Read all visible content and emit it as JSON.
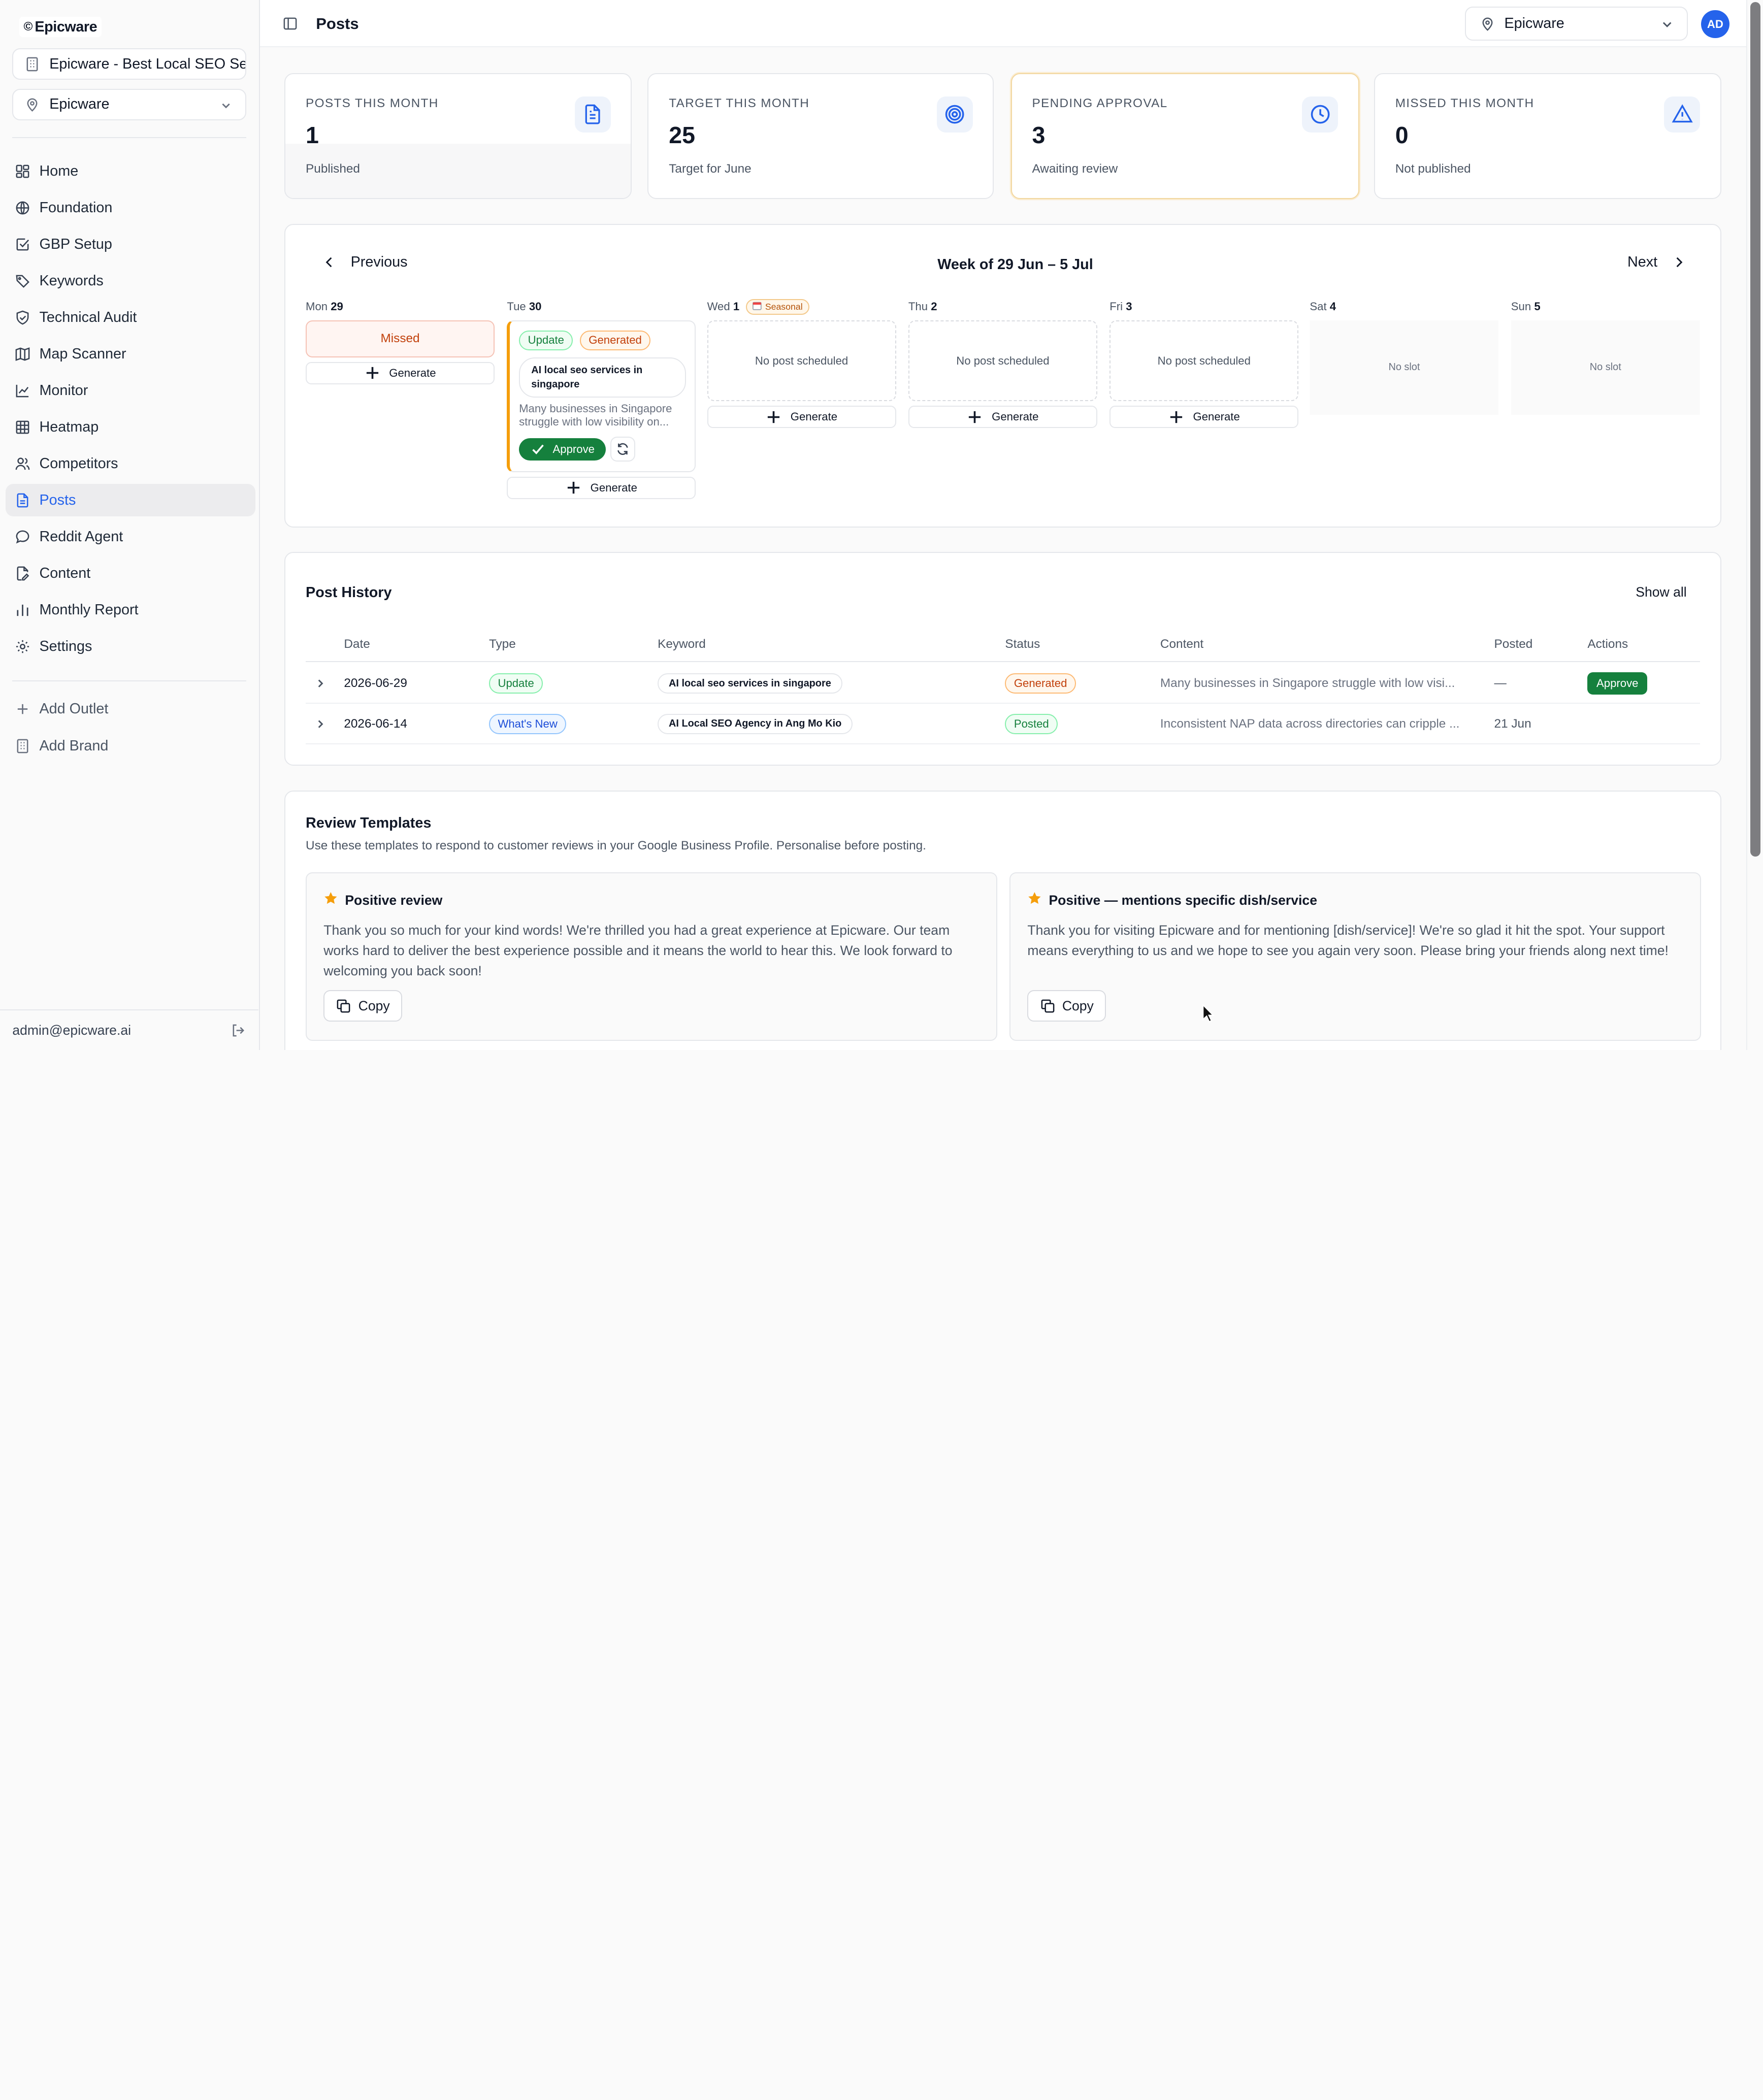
{
  "sidebar": {
    "brand": "Epicware",
    "brand_mark": "©",
    "project": "Epicware - Best Local SEO Se",
    "location": "Epicware",
    "items": [
      {
        "label": "Home",
        "icon": "dashboard-icon"
      },
      {
        "label": "Foundation",
        "icon": "globe-icon"
      },
      {
        "label": "GBP Setup",
        "icon": "checkbox-icon"
      },
      {
        "label": "Keywords",
        "icon": "tag-icon"
      },
      {
        "label": "Technical Audit",
        "icon": "shield-check-icon"
      },
      {
        "label": "Map Scanner",
        "icon": "map-icon"
      },
      {
        "label": "Monitor",
        "icon": "line-chart-icon"
      },
      {
        "label": "Heatmap",
        "icon": "grid-icon"
      },
      {
        "label": "Competitors",
        "icon": "users-icon"
      },
      {
        "label": "Posts",
        "icon": "file-icon"
      },
      {
        "label": "Reddit Agent",
        "icon": "chat-icon"
      },
      {
        "label": "Content",
        "icon": "file-edit-icon"
      },
      {
        "label": "Monthly Report",
        "icon": "bar-chart-icon"
      },
      {
        "label": "Settings",
        "icon": "gear-icon"
      }
    ],
    "active": "Posts",
    "add_outlet": "Add Outlet",
    "add_brand": "Add Brand",
    "user_email": "admin@epicware.ai"
  },
  "header": {
    "title": "Posts",
    "location": "Epicware",
    "avatar_initials": "AD"
  },
  "stats": [
    {
      "label": "POSTS THIS MONTH",
      "value": "1",
      "sub": "Published",
      "icon": "document-icon"
    },
    {
      "label": "TARGET THIS MONTH",
      "value": "25",
      "sub": "Target for June",
      "icon": "target-icon"
    },
    {
      "label": "PENDING APPROVAL",
      "value": "3",
      "sub": "Awaiting review",
      "icon": "clock-icon"
    },
    {
      "label": "MISSED THIS MONTH",
      "value": "0",
      "sub": "Not published",
      "icon": "warning-icon"
    }
  ],
  "week": {
    "prev": "Previous",
    "next": "Next",
    "title": "Week of 29 Jun – 5 Jul",
    "days": [
      {
        "name": "Mon",
        "num": "29"
      },
      {
        "name": "Tue",
        "num": "30"
      },
      {
        "name": "Wed",
        "num": "1",
        "tag": "Seasonal"
      },
      {
        "name": "Thu",
        "num": "2"
      },
      {
        "name": "Fri",
        "num": "3"
      },
      {
        "name": "Sat",
        "num": "4"
      },
      {
        "name": "Sun",
        "num": "5"
      }
    ],
    "missed": "Missed",
    "generate": "Generate",
    "no_post": "No post scheduled",
    "no_slot": "No slot",
    "post": {
      "type": "Update",
      "status": "Generated",
      "keyword": "AI local seo services in singapore",
      "snippet": "Many businesses in Singapore struggle with low visibility on...",
      "approve": "Approve"
    }
  },
  "history": {
    "title": "Post History",
    "show_all": "Show all",
    "columns": [
      "Date",
      "Type",
      "Keyword",
      "Status",
      "Content",
      "Posted",
      "Actions"
    ],
    "rows": [
      {
        "date": "2026-06-29",
        "type": "Update",
        "keyword": "AI local seo services in singapore",
        "status": "Generated",
        "content": "Many businesses in Singapore struggle with low visi...",
        "posted": "—",
        "action": "Approve"
      },
      {
        "date": "2026-06-14",
        "type": "What's New",
        "keyword": "AI Local SEO Agency in Ang Mo Kio",
        "status": "Posted",
        "content": "Inconsistent NAP data across directories can cripple ...",
        "posted": "21 Jun",
        "action": ""
      }
    ]
  },
  "reviews": {
    "title": "Review Templates",
    "desc": "Use these templates to respond to customer reviews in your Google Business Profile. Personalise before posting.",
    "templates": [
      {
        "title": "Positive review",
        "body": "Thank you so much for your kind words! We're thrilled you had a great experience at Epicware. Our team works hard to deliver the best experience possible and it means the world to hear this. We look forward to welcoming you back soon!",
        "copy": "Copy"
      },
      {
        "title": "Positive — mentions specific dish/service",
        "body": "Thank you for visiting Epicware and for mentioning [dish/service]! We're so glad it hit the spot. Your support means everything to us and we hope to see you again very soon. Please bring your friends along next time!",
        "copy": "Copy"
      }
    ]
  },
  "colors": {
    "accent": "#2563eb",
    "success": "#15803d",
    "warning": "#f59e0b",
    "danger": "#c2410c"
  }
}
